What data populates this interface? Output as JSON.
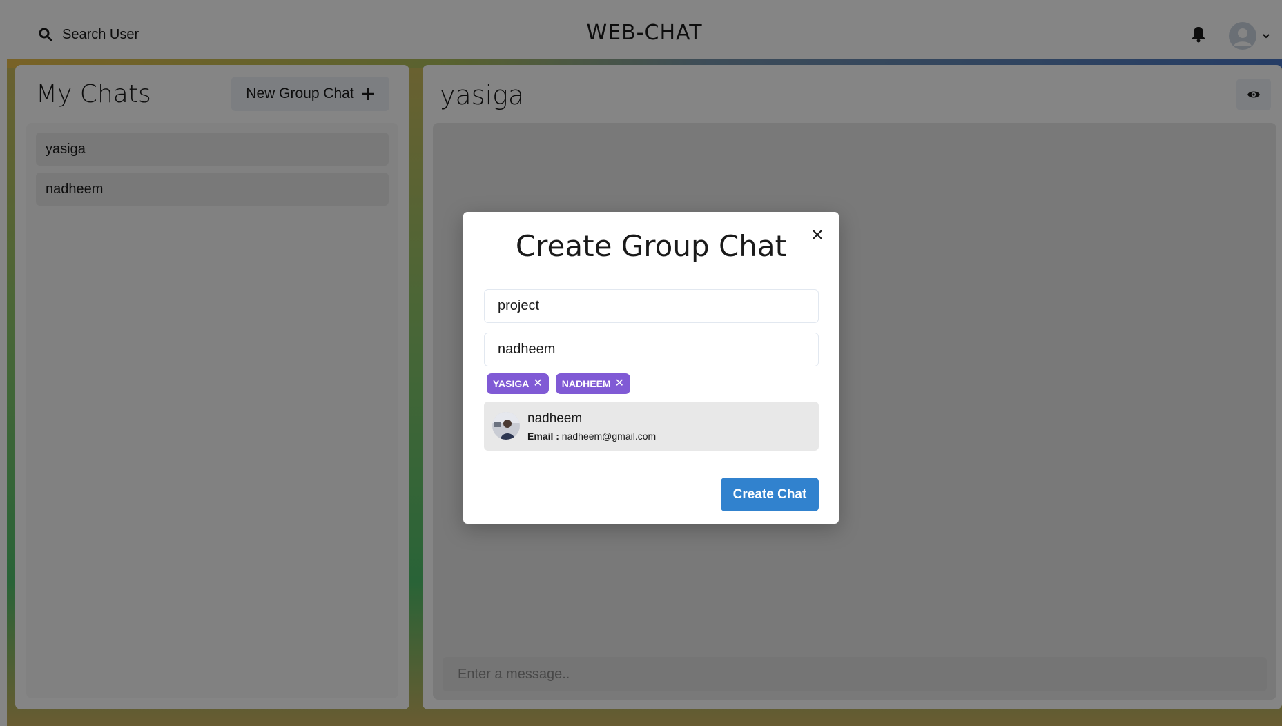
{
  "header": {
    "search_label": "Search User",
    "app_title": "WEB-CHAT"
  },
  "sidebar": {
    "title": "My Chats",
    "new_group_label": "New Group Chat",
    "chats": [
      {
        "name": "yasiga"
      },
      {
        "name": "nadheem"
      }
    ]
  },
  "chat": {
    "name": "yasiga",
    "message_placeholder": "Enter a message.."
  },
  "modal": {
    "title": "Create Group Chat",
    "chat_name_value": "project",
    "search_value": "nadheem",
    "selected_users": [
      "YASIGA",
      "NADHEEM"
    ],
    "results": [
      {
        "name": "nadheem",
        "email_label": "Email :",
        "email": "nadheem@gmail.com"
      }
    ],
    "create_label": "Create Chat"
  },
  "colors": {
    "tag": "#805ad5",
    "primary_button": "#3182ce"
  }
}
